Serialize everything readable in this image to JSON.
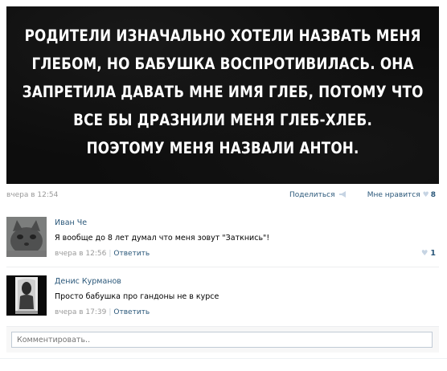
{
  "post": {
    "image_lines": [
      "РОДИТЕЛИ ИЗНАЧАЛЬНО ХОТЕЛИ НАЗВАТЬ МЕНЯ",
      "ГЛЕБОМ, НО БАБУШКА ВОСПРОТИВИЛАСЬ. ОНА",
      "ЗАПРЕТИЛА ДАВАТЬ МНЕ ИМЯ ГЛЕБ, ПОТОМУ ЧТО",
      "ВСЕ БЫ ДРАЗНИЛИ МЕНЯ ГЛЕБ-ХЛЕБ.",
      "ПОЭТОМУ МЕНЯ НАЗВАЛИ АНТОН."
    ],
    "date": "вчера в 12:54",
    "share_label": "Поделиться",
    "like_label": "Мне нравится",
    "like_count": "8"
  },
  "comments": [
    {
      "author": "Иван Че",
      "text": "Я вообще до 8 лет думал что меня зовут \"Заткнись\"!",
      "time": "вчера в 12:56",
      "reply_label": "Ответить",
      "likes": "1"
    },
    {
      "author": "Денис Курманов",
      "text": "Просто бабушка про гандоны не в курсе",
      "time": "вчера в 17:39",
      "reply_label": "Ответить"
    }
  ],
  "comment_input": {
    "placeholder": "Комментировать.."
  },
  "colors": {
    "link": "#2b587a",
    "muted": "#999999",
    "heart": "#c6d4e3"
  }
}
